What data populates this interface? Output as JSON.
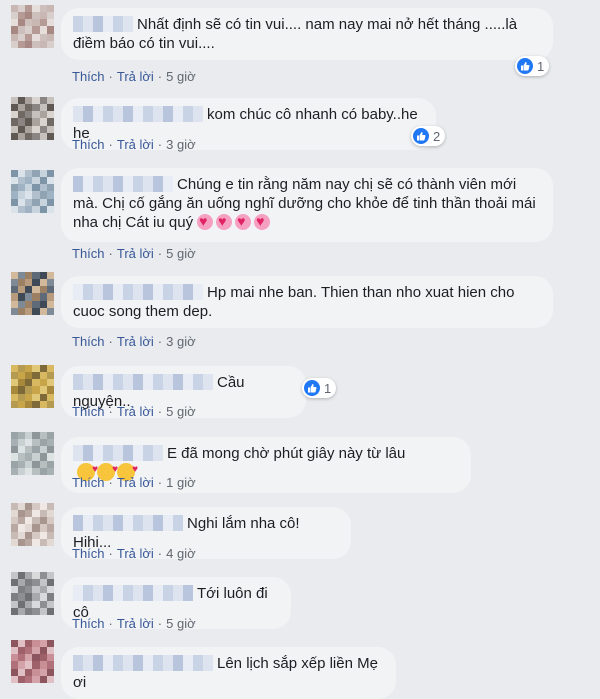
{
  "comments": [
    {
      "text": "Nhất định sẽ có tin vui.... nam nay mai nở hết tháng .....là điềm báo có tin vui....",
      "reaction_count": "1",
      "like_label": "Thích",
      "reply_label": "Trả lời",
      "time": "5 giờ",
      "avatar_palette": [
        "#c9b7b3",
        "#d8cfcc",
        "#b59a96",
        "#e6dedb",
        "#a88883",
        "#cdbfbb"
      ]
    },
    {
      "text": "kom chúc cô nhanh có baby..he he",
      "reaction_count": "2",
      "like_label": "Thích",
      "reply_label": "Trả lời",
      "time": "3 giờ",
      "avatar_palette": [
        "#8a8583",
        "#c7c1bd",
        "#5f5853",
        "#a9a29d",
        "#d9d4d0",
        "#6f6863"
      ]
    },
    {
      "text": "Chúng e tin rằng năm nay chị sẽ có thành viên mới mà. Chị cố gắng ăn uống nghĩ dưỡng cho khỏe để tinh thần thoải mái nha chị Cát iu quý",
      "emoji": "hearts",
      "like_label": "Thích",
      "reply_label": "Trả lời",
      "time": "5 giờ",
      "avatar_palette": [
        "#9fb3c4",
        "#c7d3dd",
        "#7e95a8",
        "#dbe3ea",
        "#b1c0cc",
        "#8fa3b3"
      ]
    },
    {
      "text": "Hp mai nhe ban. Thien than nho xuat hien cho cuoc song them dep.",
      "like_label": "Thích",
      "reply_label": "Trả lời",
      "time": "3 giờ",
      "avatar_palette": [
        "#5e6a78",
        "#b89b7d",
        "#3f4a56",
        "#d2b99c",
        "#7e8a96",
        "#9c8064"
      ]
    },
    {
      "text": "Cầu nguyện..",
      "reaction_count": "1",
      "like_label": "Thích",
      "reply_label": "Trả lời",
      "time": "5 giờ",
      "avatar_palette": [
        "#c9a54a",
        "#e0c878",
        "#a8893c",
        "#7e6a38",
        "#d8b860",
        "#b59a52"
      ]
    },
    {
      "text": "E đã mong chờ phút giây này từ lâu",
      "emoji": "kisses",
      "like_label": "Thích",
      "reply_label": "Trả lời",
      "time": "1 giờ",
      "avatar_palette": [
        "#a7b0b3",
        "#c9d0d2",
        "#8e9699",
        "#dde2e3",
        "#b7bfc1",
        "#9aa3a6"
      ]
    },
    {
      "text": "Nghi lắm nha cô! Hihi...",
      "like_label": "Thích",
      "reply_label": "Trả lời",
      "time": "4 giờ",
      "avatar_palette": [
        "#c8bab5",
        "#e2d8d4",
        "#a8958e",
        "#d6c8c2",
        "#b9a8a1",
        "#efe8e5"
      ]
    },
    {
      "text": "Tới luôn đi cô",
      "like_label": "Thích",
      "reply_label": "Trả lời",
      "time": "5 giờ",
      "avatar_palette": [
        "#8d8f93",
        "#c3c5c8",
        "#6e7074",
        "#a7a9ac",
        "#d8d9db",
        "#7d7f83"
      ]
    },
    {
      "text": "Lên lịch sắp xếp liền Mẹ ơi",
      "avatar_palette": [
        "#b0717a",
        "#d4a3a9",
        "#8d555e",
        "#e0c0c4",
        "#9f6169",
        "#c98f96"
      ]
    }
  ],
  "colors": {
    "background": "#e9ebee",
    "bubble": "#f2f3f5",
    "link": "#385898",
    "muted": "#606770",
    "like_blue": "#2078f4"
  },
  "icons": {
    "reaction": "like-icon",
    "hearts": "heart-emoji",
    "kisses": "kiss-emoji"
  }
}
